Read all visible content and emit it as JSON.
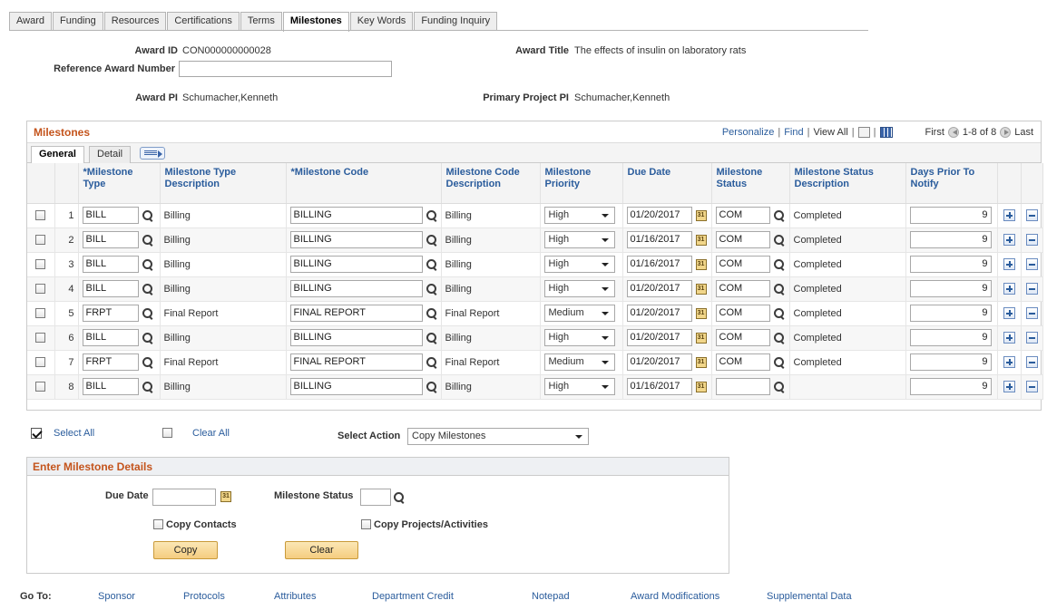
{
  "tabs": [
    "Award",
    "Funding",
    "Resources",
    "Certifications",
    "Terms",
    "Milestones",
    "Key Words",
    "Funding Inquiry"
  ],
  "active_tab": "Milestones",
  "header": {
    "award_id_label": "Award ID",
    "award_id": "CON000000000028",
    "award_title_label": "Award Title",
    "award_title": "The effects of insulin on laboratory rats",
    "ref_award_label": "Reference Award Number",
    "ref_award_value": "",
    "award_pi_label": "Award PI",
    "award_pi": "Schumacher,Kenneth",
    "primary_pi_label": "Primary Project PI",
    "primary_pi": "Schumacher,Kenneth"
  },
  "grid": {
    "title": "Milestones",
    "personalize": "Personalize",
    "find": "Find",
    "view_all": "View All",
    "first": "First",
    "range": "1-8 of 8",
    "last": "Last",
    "subtabs": [
      "General",
      "Detail"
    ],
    "columns": [
      "*Milestone Type",
      "Milestone Type Description",
      "*Milestone Code",
      "Milestone Code Description",
      "Milestone Priority",
      "Due Date",
      "Milestone Status",
      "Milestone Status Description",
      "Days Prior To Notify"
    ],
    "rows": [
      {
        "n": "1",
        "type": "BILL",
        "type_desc": "Billing",
        "code": "BILLING",
        "code_desc": "Billing",
        "priority": "High",
        "due": "01/20/2017",
        "status": "COM",
        "status_desc": "Completed",
        "days": "9"
      },
      {
        "n": "2",
        "type": "BILL",
        "type_desc": "Billing",
        "code": "BILLING",
        "code_desc": "Billing",
        "priority": "High",
        "due": "01/16/2017",
        "status": "COM",
        "status_desc": "Completed",
        "days": "9"
      },
      {
        "n": "3",
        "type": "BILL",
        "type_desc": "Billing",
        "code": "BILLING",
        "code_desc": "Billing",
        "priority": "High",
        "due": "01/16/2017",
        "status": "COM",
        "status_desc": "Completed",
        "days": "9"
      },
      {
        "n": "4",
        "type": "BILL",
        "type_desc": "Billing",
        "code": "BILLING",
        "code_desc": "Billing",
        "priority": "High",
        "due": "01/20/2017",
        "status": "COM",
        "status_desc": "Completed",
        "days": "9"
      },
      {
        "n": "5",
        "type": "FRPT",
        "type_desc": "Final Report",
        "code": "FINAL REPORT",
        "code_desc": "Final Report",
        "priority": "Medium",
        "due": "01/20/2017",
        "status": "COM",
        "status_desc": "Completed",
        "days": "9"
      },
      {
        "n": "6",
        "type": "BILL",
        "type_desc": "Billing",
        "code": "BILLING",
        "code_desc": "Billing",
        "priority": "High",
        "due": "01/20/2017",
        "status": "COM",
        "status_desc": "Completed",
        "days": "9"
      },
      {
        "n": "7",
        "type": "FRPT",
        "type_desc": "Final Report",
        "code": "FINAL REPORT",
        "code_desc": "Final Report",
        "priority": "Medium",
        "due": "01/20/2017",
        "status": "COM",
        "status_desc": "Completed",
        "days": "9"
      },
      {
        "n": "8",
        "type": "BILL",
        "type_desc": "Billing",
        "code": "BILLING",
        "code_desc": "Billing",
        "priority": "High",
        "due": "01/16/2017",
        "status": "",
        "status_desc": "",
        "days": "9"
      }
    ]
  },
  "actions": {
    "select_all": "Select All",
    "clear_all": "Clear All",
    "select_action_label": "Select Action",
    "select_action_value": "Copy Milestones"
  },
  "details": {
    "title": "Enter Milestone Details",
    "due_date_label": "Due Date",
    "due_date_value": "",
    "status_label": "Milestone Status",
    "status_value": "",
    "copy_contacts": "Copy Contacts",
    "copy_projects": "Copy Projects/Activities",
    "copy_button": "Copy",
    "clear_button": "Clear"
  },
  "goto": {
    "label": "Go To:",
    "links": [
      "Sponsor",
      "Protocols",
      "Attributes",
      "Department Credit",
      "Notepad",
      "Award Modifications",
      "Supplemental Data"
    ]
  },
  "colors": {
    "accent_orange": "#c4541c",
    "link_blue": "#2a5c9c",
    "button_gold": "#f5cd80"
  }
}
